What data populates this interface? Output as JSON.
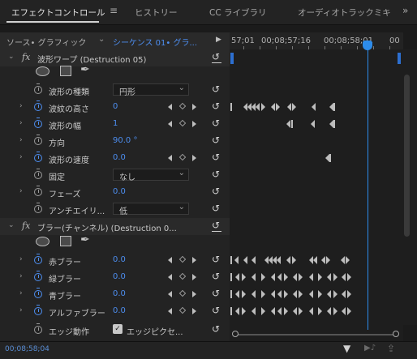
{
  "tabs": [
    {
      "label": "エフェクトコントロール",
      "active": true
    },
    {
      "label": "ヒストリー",
      "active": false
    },
    {
      "label": "CC ライブラリ",
      "active": false
    },
    {
      "label": "オーディオトラックミキ",
      "active": false
    }
  ],
  "tab_menu_glyph": "≡",
  "overflow_glyph": "»",
  "source_label": "ソース• グラフィック",
  "sequence_label": "シーケンス 01• グラ...",
  "timeline": {
    "times": [
      "57;01",
      "00;08;57;16",
      "00;08;58;01",
      "00"
    ],
    "current_timecode": "00;08;58;04"
  },
  "effects": [
    {
      "name": "波形ワープ (Destruction 05)",
      "params": [
        {
          "label": "波形の種類",
          "type": "dropdown",
          "value": "円形",
          "stopwatch": "off"
        },
        {
          "label": "波紋の高さ",
          "type": "value",
          "value": "0",
          "stopwatch": "on",
          "keyframes": true
        },
        {
          "label": "波形の幅",
          "type": "value",
          "value": "1",
          "stopwatch": "on",
          "keyframes": true
        },
        {
          "label": "方向",
          "type": "value",
          "value": "90.0 °",
          "stopwatch": "off"
        },
        {
          "label": "波形の速度",
          "type": "value",
          "value": "0.0",
          "stopwatch": "on",
          "keyframes": true
        },
        {
          "label": "固定",
          "type": "dropdown",
          "value": "なし",
          "stopwatch": "off"
        },
        {
          "label": "フェーズ",
          "type": "value",
          "value": "0.0",
          "stopwatch": "off"
        },
        {
          "label": "アンチエイリ...",
          "type": "dropdown",
          "value": "低",
          "stopwatch": "off"
        }
      ]
    },
    {
      "name": "ブラー(チャンネル) (Destruction 0...",
      "params": [
        {
          "label": "赤ブラー",
          "type": "value",
          "value": "0.0",
          "stopwatch": "on",
          "keyframes": true
        },
        {
          "label": "緑ブラー",
          "type": "value",
          "value": "0.0",
          "stopwatch": "on",
          "keyframes": true
        },
        {
          "label": "青ブラー",
          "type": "value",
          "value": "0.0",
          "stopwatch": "on",
          "keyframes": true
        },
        {
          "label": "アルファブラー",
          "type": "value",
          "value": "0.0",
          "stopwatch": "on",
          "keyframes": true
        },
        {
          "label": "エッジ動作",
          "type": "checkbox",
          "value": "エッジピクセ...",
          "checked": true,
          "stopwatch": "off"
        }
      ]
    }
  ],
  "icons": {
    "fx": "fx",
    "reset": "↺",
    "pen": "✒",
    "checkmark": "✓",
    "filter": "▼",
    "audio": "▶♪",
    "export": "⇪"
  }
}
